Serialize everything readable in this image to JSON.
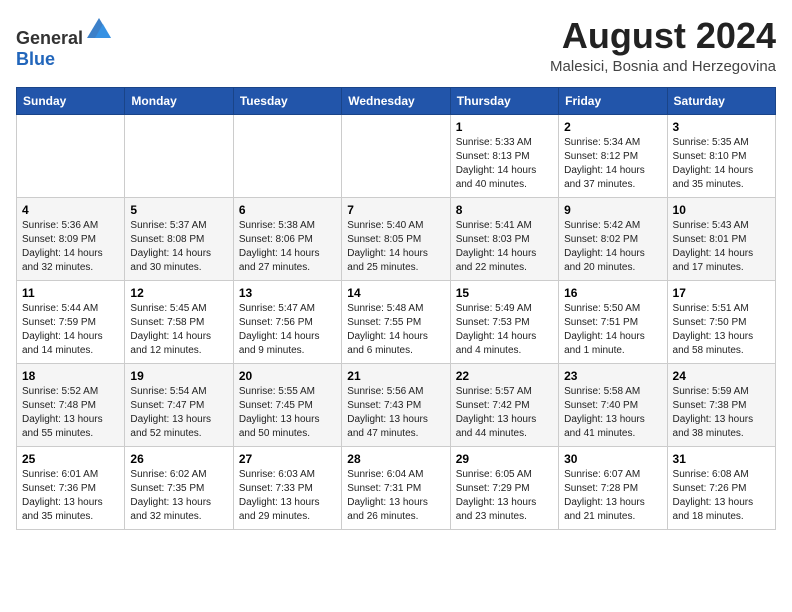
{
  "header": {
    "logo_general": "General",
    "logo_blue": "Blue",
    "title": "August 2024",
    "location": "Malesici, Bosnia and Herzegovina"
  },
  "days_of_week": [
    "Sunday",
    "Monday",
    "Tuesday",
    "Wednesday",
    "Thursday",
    "Friday",
    "Saturday"
  ],
  "weeks": [
    [
      {
        "day": "",
        "info": ""
      },
      {
        "day": "",
        "info": ""
      },
      {
        "day": "",
        "info": ""
      },
      {
        "day": "",
        "info": ""
      },
      {
        "day": "1",
        "info": "Sunrise: 5:33 AM\nSunset: 8:13 PM\nDaylight: 14 hours\nand 40 minutes."
      },
      {
        "day": "2",
        "info": "Sunrise: 5:34 AM\nSunset: 8:12 PM\nDaylight: 14 hours\nand 37 minutes."
      },
      {
        "day": "3",
        "info": "Sunrise: 5:35 AM\nSunset: 8:10 PM\nDaylight: 14 hours\nand 35 minutes."
      }
    ],
    [
      {
        "day": "4",
        "info": "Sunrise: 5:36 AM\nSunset: 8:09 PM\nDaylight: 14 hours\nand 32 minutes."
      },
      {
        "day": "5",
        "info": "Sunrise: 5:37 AM\nSunset: 8:08 PM\nDaylight: 14 hours\nand 30 minutes."
      },
      {
        "day": "6",
        "info": "Sunrise: 5:38 AM\nSunset: 8:06 PM\nDaylight: 14 hours\nand 27 minutes."
      },
      {
        "day": "7",
        "info": "Sunrise: 5:40 AM\nSunset: 8:05 PM\nDaylight: 14 hours\nand 25 minutes."
      },
      {
        "day": "8",
        "info": "Sunrise: 5:41 AM\nSunset: 8:03 PM\nDaylight: 14 hours\nand 22 minutes."
      },
      {
        "day": "9",
        "info": "Sunrise: 5:42 AM\nSunset: 8:02 PM\nDaylight: 14 hours\nand 20 minutes."
      },
      {
        "day": "10",
        "info": "Sunrise: 5:43 AM\nSunset: 8:01 PM\nDaylight: 14 hours\nand 17 minutes."
      }
    ],
    [
      {
        "day": "11",
        "info": "Sunrise: 5:44 AM\nSunset: 7:59 PM\nDaylight: 14 hours\nand 14 minutes."
      },
      {
        "day": "12",
        "info": "Sunrise: 5:45 AM\nSunset: 7:58 PM\nDaylight: 14 hours\nand 12 minutes."
      },
      {
        "day": "13",
        "info": "Sunrise: 5:47 AM\nSunset: 7:56 PM\nDaylight: 14 hours\nand 9 minutes."
      },
      {
        "day": "14",
        "info": "Sunrise: 5:48 AM\nSunset: 7:55 PM\nDaylight: 14 hours\nand 6 minutes."
      },
      {
        "day": "15",
        "info": "Sunrise: 5:49 AM\nSunset: 7:53 PM\nDaylight: 14 hours\nand 4 minutes."
      },
      {
        "day": "16",
        "info": "Sunrise: 5:50 AM\nSunset: 7:51 PM\nDaylight: 14 hours\nand 1 minute."
      },
      {
        "day": "17",
        "info": "Sunrise: 5:51 AM\nSunset: 7:50 PM\nDaylight: 13 hours\nand 58 minutes."
      }
    ],
    [
      {
        "day": "18",
        "info": "Sunrise: 5:52 AM\nSunset: 7:48 PM\nDaylight: 13 hours\nand 55 minutes."
      },
      {
        "day": "19",
        "info": "Sunrise: 5:54 AM\nSunset: 7:47 PM\nDaylight: 13 hours\nand 52 minutes."
      },
      {
        "day": "20",
        "info": "Sunrise: 5:55 AM\nSunset: 7:45 PM\nDaylight: 13 hours\nand 50 minutes."
      },
      {
        "day": "21",
        "info": "Sunrise: 5:56 AM\nSunset: 7:43 PM\nDaylight: 13 hours\nand 47 minutes."
      },
      {
        "day": "22",
        "info": "Sunrise: 5:57 AM\nSunset: 7:42 PM\nDaylight: 13 hours\nand 44 minutes."
      },
      {
        "day": "23",
        "info": "Sunrise: 5:58 AM\nSunset: 7:40 PM\nDaylight: 13 hours\nand 41 minutes."
      },
      {
        "day": "24",
        "info": "Sunrise: 5:59 AM\nSunset: 7:38 PM\nDaylight: 13 hours\nand 38 minutes."
      }
    ],
    [
      {
        "day": "25",
        "info": "Sunrise: 6:01 AM\nSunset: 7:36 PM\nDaylight: 13 hours\nand 35 minutes."
      },
      {
        "day": "26",
        "info": "Sunrise: 6:02 AM\nSunset: 7:35 PM\nDaylight: 13 hours\nand 32 minutes."
      },
      {
        "day": "27",
        "info": "Sunrise: 6:03 AM\nSunset: 7:33 PM\nDaylight: 13 hours\nand 29 minutes."
      },
      {
        "day": "28",
        "info": "Sunrise: 6:04 AM\nSunset: 7:31 PM\nDaylight: 13 hours\nand 26 minutes."
      },
      {
        "day": "29",
        "info": "Sunrise: 6:05 AM\nSunset: 7:29 PM\nDaylight: 13 hours\nand 23 minutes."
      },
      {
        "day": "30",
        "info": "Sunrise: 6:07 AM\nSunset: 7:28 PM\nDaylight: 13 hours\nand 21 minutes."
      },
      {
        "day": "31",
        "info": "Sunrise: 6:08 AM\nSunset: 7:26 PM\nDaylight: 13 hours\nand 18 minutes."
      }
    ]
  ]
}
